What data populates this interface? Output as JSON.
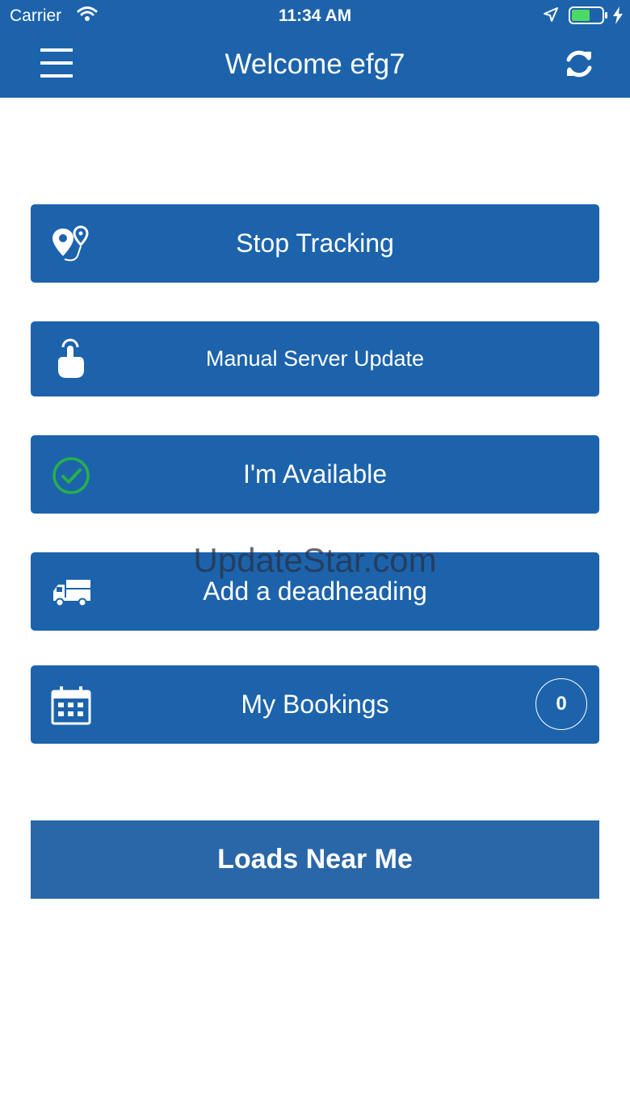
{
  "status_bar": {
    "carrier": "Carrier",
    "time": "11:34 AM"
  },
  "nav": {
    "title": "Welcome efg7",
    "menu_icon": "hamburger-menu-icon",
    "refresh_icon": "refresh-icon"
  },
  "actions": [
    {
      "label": "Stop Tracking",
      "icon": "route-pins-icon"
    },
    {
      "label": "Manual Server Update",
      "icon": "tap-hand-icon"
    },
    {
      "label": "I'm Available",
      "icon": "check-circle-icon"
    },
    {
      "label": "Add a deadheading",
      "icon": "truck-icon"
    },
    {
      "label": "My Bookings",
      "icon": "calendar-icon",
      "badge": "0"
    }
  ],
  "loads_button": {
    "label": "Loads Near Me"
  },
  "watermark": "UpdateStar.com",
  "colors": {
    "primary": "#1c63ac",
    "loads_button": "#2a67a8",
    "available_green": "#27b04b",
    "battery_green": "#4cd964"
  }
}
